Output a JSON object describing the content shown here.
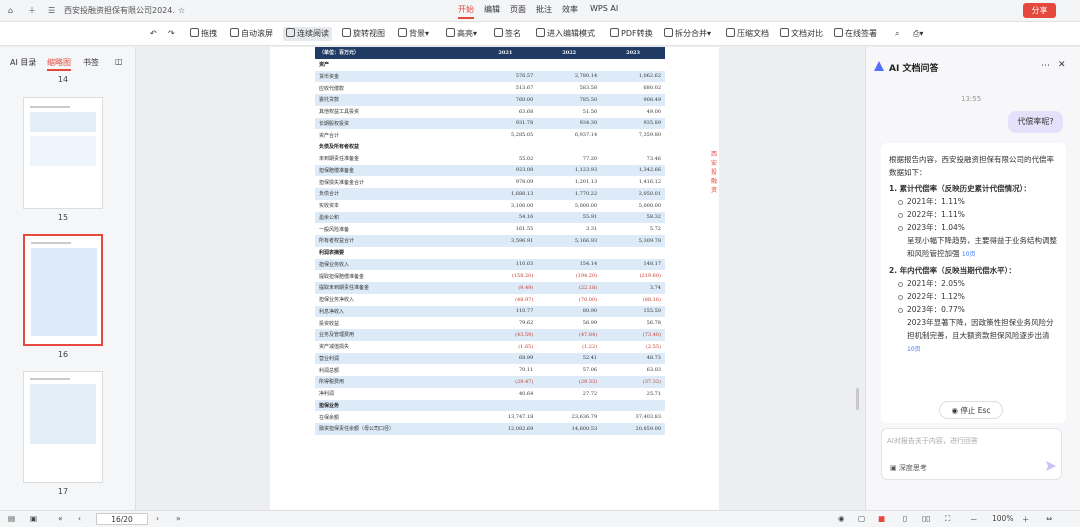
{
  "titlebar": {
    "doc_tab": "西安投融资担保有限公司2024...",
    "menus": [
      "开始",
      "编辑",
      "页面",
      "批注",
      "效率",
      "WPS AI"
    ],
    "active_menu": "开始",
    "share": "分享"
  },
  "toolbar": {
    "tools": [
      "拖拽",
      "自动滚屏",
      "连续阅读",
      "旋转视图",
      "背景",
      "高亮",
      "签名",
      "进入编辑模式",
      "PDF转换",
      "拆分合并",
      "压缩文档",
      "文档对比",
      "在线签署"
    ]
  },
  "leftpanel": {
    "tabs": [
      "AI 目录",
      "缩略图",
      "书签"
    ],
    "active_tab": "缩略图",
    "pages": [
      "14",
      "15",
      "16",
      "17"
    ]
  },
  "table": {
    "header": [
      "（单位：百万元）",
      "2021",
      "2022",
      "2023"
    ],
    "rows": [
      {
        "type": "sec",
        "c": [
          "资产",
          "",
          "",
          ""
        ]
      },
      {
        "c": [
          "货币资金",
          "576.57",
          "2,780.14",
          "1,062.62"
        ],
        "s": 1
      },
      {
        "c": [
          "应收代偿款",
          "513.67",
          "583.58",
          "680.02"
        ],
        "s": 0
      },
      {
        "c": [
          "委托贷款",
          "760.00",
          "785.50",
          "908.49"
        ],
        "s": 1
      },
      {
        "c": [
          "其他权益工具投资",
          "63.68",
          "51.50",
          "49.00"
        ],
        "s": 0
      },
      {
        "c": [
          "长期股权投资",
          "931.78",
          "934.30",
          "935.89"
        ],
        "s": 1
      },
      {
        "c": [
          "资产合计",
          "5,285.05",
          "6,937.14",
          "7,359.80"
        ],
        "s": 0
      },
      {
        "type": "sec",
        "c": [
          "负债及所有者权益",
          "",
          "",
          ""
        ]
      },
      {
        "c": [
          "未到期责任准备金",
          "55.02",
          "77.20",
          "73.46"
        ],
        "s": 0
      },
      {
        "c": [
          "担保赔偿准备金",
          "923.08",
          "1,123.93",
          "1,342.66"
        ],
        "s": 1
      },
      {
        "c": [
          "担保损失准备金合计",
          "978.09",
          "1,201.13",
          "1,416.12"
        ],
        "s": 0
      },
      {
        "c": [
          "负债合计",
          "1,688.13",
          "1,770.22",
          "2,050.01"
        ],
        "s": 1
      },
      {
        "c": [
          "实收资本",
          "3,100.00",
          "5,000.00",
          "5,000.00"
        ],
        "s": 0
      },
      {
        "c": [
          "盈余公积",
          "54.16",
          "55.91",
          "58.32"
        ],
        "s": 1
      },
      {
        "c": [
          "一般风险准备",
          "161.55",
          "3.31",
          "5.72"
        ],
        "s": 0
      },
      {
        "c": [
          "所有者权益合计",
          "3,596.91",
          "5,166.93",
          "5,309.78"
        ],
        "s": 1
      },
      {
        "type": "sec",
        "c": [
          "利润表摘要",
          "",
          "",
          ""
        ]
      },
      {
        "c": [
          "担保业务收入",
          "110.03",
          "154.14",
          "148.17"
        ],
        "s": 1
      },
      {
        "c": [
          "提取担保赔偿准备金",
          "(158.20)",
          "(194.20)",
          "(219.60)"
        ],
        "s": 0,
        "neg": 1
      },
      {
        "c": [
          "提取未到期责任准备金",
          "(9.49)",
          "(22.18)",
          "3.74"
        ],
        "s": 1,
        "neg": 1
      },
      {
        "c": [
          "担保业务净收入",
          "(48.97)",
          "(70.00)",
          "(88.16)"
        ],
        "s": 0,
        "neg": 1
      },
      {
        "c": [
          "利息净收入",
          "110.77",
          "80.90",
          "155.50"
        ],
        "s": 1
      },
      {
        "c": [
          "投资收益",
          "79.62",
          "56.99",
          "56.78"
        ],
        "s": 0
      },
      {
        "c": [
          "业务及管理费用",
          "(43.59)",
          "(47.84)",
          "(73.40)"
        ],
        "s": 1,
        "neg": 1
      },
      {
        "c": [
          "资产减值损失",
          "(1.65)",
          "(1.22)",
          "(2.55)"
        ],
        "s": 0,
        "neg": 1
      },
      {
        "c": [
          "营业利润",
          "68.99",
          "52.41",
          "48.73"
        ],
        "s": 1
      },
      {
        "c": [
          "利润总额",
          "70.11",
          "57.06",
          "63.03"
        ],
        "s": 0
      },
      {
        "c": [
          "所得税费用",
          "(29.47)",
          "(29.33)",
          "(37.32)"
        ],
        "s": 1,
        "neg": 1
      },
      {
        "c": [
          "净利润",
          "40.64",
          "27.72",
          "25.71"
        ],
        "s": 0
      },
      {
        "type": "sec",
        "c": [
          "担保业务",
          "",
          "",
          ""
        ],
        "s": 1
      },
      {
        "c": [
          "在保余额",
          "13,747.18",
          "23,636.79",
          "37,403.83"
        ],
        "s": 0
      },
      {
        "c": [
          "融资担保责任余额（母公司口径）",
          "12,082.69",
          "14,600.53",
          "20,859.00"
        ],
        "s": 1
      }
    ]
  },
  "ai": {
    "title": "AI 文档问答",
    "time": "13:55",
    "question": "代偿率呢?",
    "intro": "根据报告内容，西安投融资担保有限公司的代偿率数据如下：",
    "s1_title": "1. 累计代偿率（反映历史累计代偿情况）：",
    "s1": [
      "2021年：1.11%",
      "2022年：1.11%",
      "2023年：1.04%"
    ],
    "s1_note": "呈现小幅下降趋势，主要得益于业务结构调整和风险管控加强",
    "cite1": "10页",
    "s2_title": "2. 年内代偿率（反映当期代偿水平）：",
    "s2": [
      "2021年：2.05%",
      "2022年：1.12%",
      "2023年：0.77%"
    ],
    "s2_note": "2023年显著下降，因政策性担保业务风险分担机制完善，且大额资款担保风险逐步出清",
    "cite2": "10页",
    "stop": "停止 Esc",
    "input_ph": "AI对报告关于内容，进行回答",
    "deep": "深度思考"
  },
  "statusbar": {
    "page": "16/20",
    "zoom": "100%"
  }
}
